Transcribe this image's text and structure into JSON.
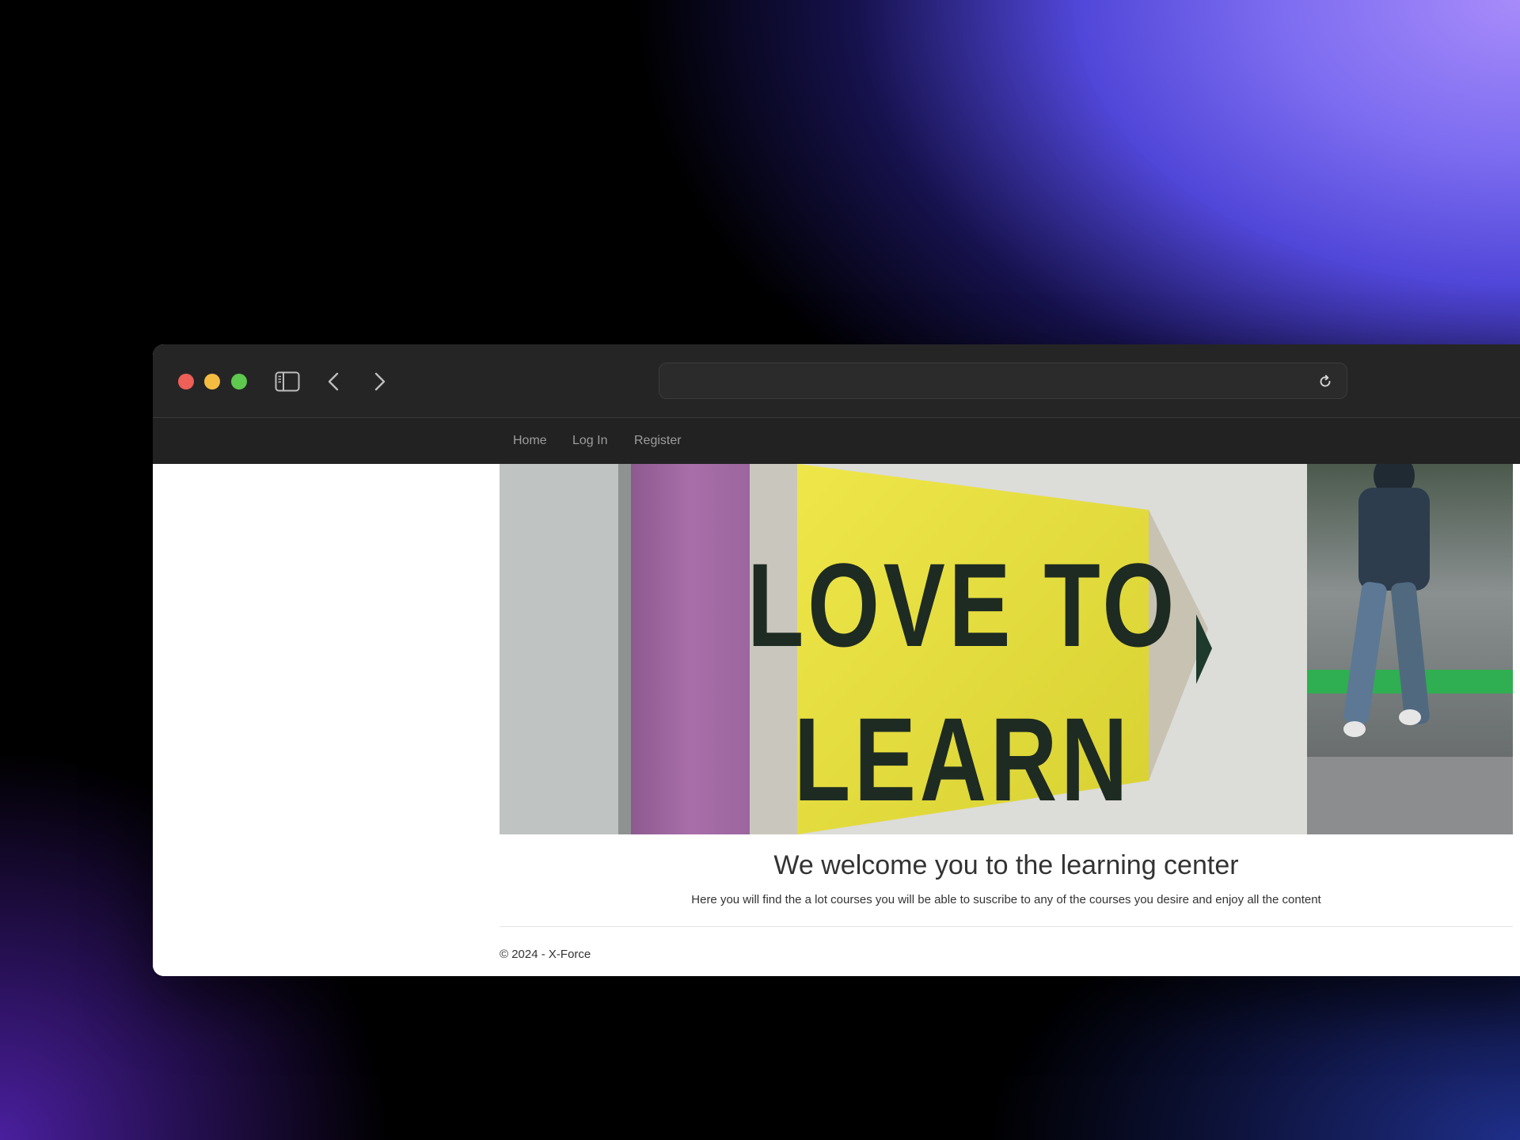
{
  "browser": {
    "url": "",
    "controls": {
      "sidebar_icon": "sidebar-toggle-icon",
      "back_icon": "chevron-left-icon",
      "forward_icon": "chevron-right-icon",
      "reload_icon": "reload-icon"
    },
    "traffic_lights": {
      "close_color": "#ed5f57",
      "minimize_color": "#f4bd41",
      "zoom_color": "#5ec84f"
    }
  },
  "nav": {
    "links": [
      {
        "label": "Home"
      },
      {
        "label": "Log In"
      },
      {
        "label": "Register"
      }
    ]
  },
  "hero": {
    "image": "love-to-learn-pencil-sign-photo",
    "sign_text_line1": "LOVE TO",
    "sign_text_line2": "LEARN"
  },
  "main": {
    "title": "We welcome you to the learning center",
    "subtitle": "Here you will find the a lot courses you will be able to suscribe to any of the courses you desire and enjoy all the content"
  },
  "footer": {
    "text": "© 2024 - X-Force"
  },
  "colors": {
    "navbar_bg": "#222222",
    "titlebar_bg": "#252526",
    "nav_link": "#9d9d9d",
    "pencil_yellow": "#e3dc3c",
    "pencil_pink": "#a668a8"
  }
}
